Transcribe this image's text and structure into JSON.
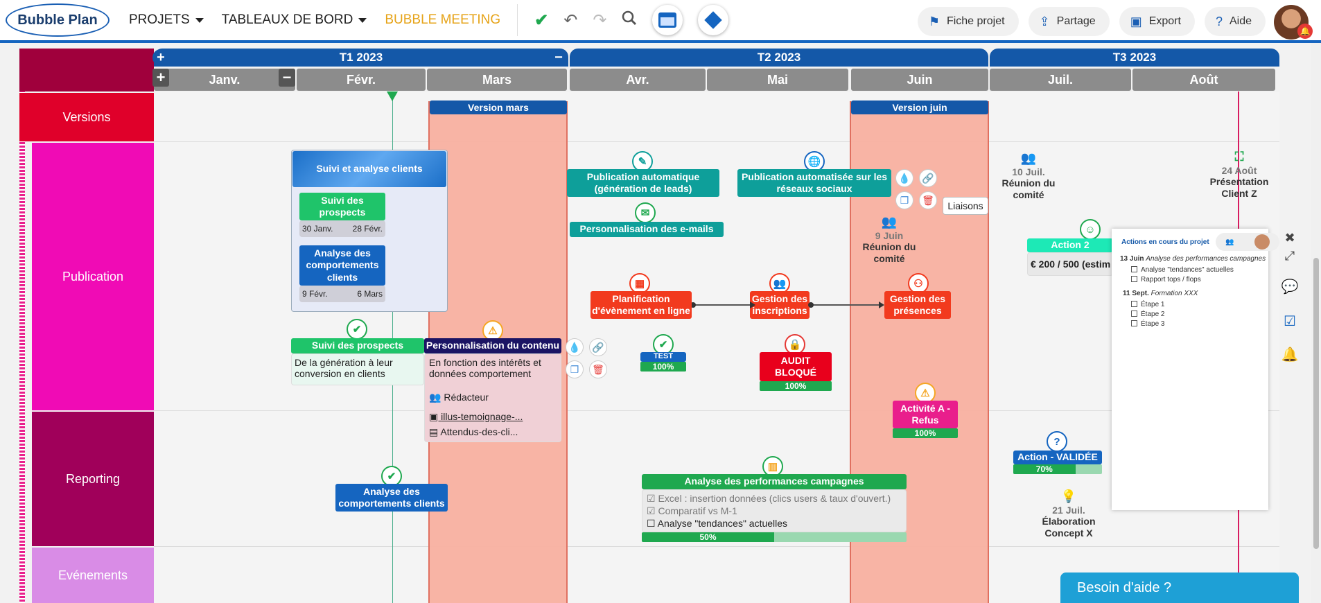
{
  "topbar": {
    "logo_text": "Bubble Plan",
    "nav": [
      {
        "label": "PROJETS"
      },
      {
        "label": "TABLEAUX DE BORD"
      },
      {
        "label": "BUBBLE MEETING"
      }
    ],
    "right_buttons": [
      {
        "label": "Fiche projet",
        "icon": "flag-icon"
      },
      {
        "label": "Partage",
        "icon": "share-icon"
      },
      {
        "label": "Export",
        "icon": "image-icon"
      },
      {
        "label": "Aide",
        "icon": "help-icon"
      }
    ]
  },
  "timeline": {
    "quarters": [
      "T1 2023",
      "T2 2023",
      "T3 2023"
    ],
    "months": [
      "Janv.",
      "Févr.",
      "Mars",
      "Avr.",
      "Mai",
      "Juin",
      "Juil.",
      "Août"
    ],
    "versions": [
      "Version mars",
      "Version juin"
    ]
  },
  "rows": [
    "Versions",
    "Publication",
    "Reporting",
    "Evénements"
  ],
  "tasks": {
    "suivi_analyse_title": "Suivi et analyse clients",
    "suivi_prospects_sub": "Suivi des prospects",
    "suivi_prospects_start": "30 Janv.",
    "suivi_prospects_end": "28 Févr.",
    "analyse_comp_sub": "Analyse des comportements clients",
    "analyse_comp_start": "9 Févr.",
    "analyse_comp_end": "6 Mars",
    "suivi_prospects_title": "Suivi des prospects",
    "suivi_prospects_desc": "De la génération à leur conversion en clients",
    "perso_title": "Personnalisation du contenu",
    "perso_desc": "En fonction des intérêts et données comportement",
    "perso_role": "Rédacteur",
    "perso_file1": "illus-temoignage-...",
    "perso_file2": "Attendus-des-cli...",
    "pub_auto_leads": "Publication automatique (génération de leads)",
    "perso_emails": "Personnalisation des e-mails",
    "pub_auto_social": "Publication automatisée sur les réseaux sociaux",
    "tooltip_liaisons": "Liaisons",
    "planif": "Planification d'évènement en ligne",
    "gestion_inscr": "Gestion des inscriptions",
    "gestion_pres": "Gestion des présences",
    "test_label": "TEST",
    "test_progress": "100%",
    "audit_label": "AUDIT BLOQUÉ",
    "audit_progress": "100%",
    "activite_label": "Activité A - Refus",
    "activite_progress": "100%",
    "analyse_comp2": "Analyse des comportements clients",
    "analyse_perf_title": "Analyse des performances campagnes",
    "analyse_perf_items": [
      "Excel : insertion données (clics users & taux d'ouvert.)",
      "Comparatif vs M-1",
      "Analyse \"tendances\" actuelles"
    ],
    "analyse_perf_progress": "50%",
    "action_validee": "Action - VALIDÉE",
    "action_validee_progress": "70%",
    "action2_label": "Action 2",
    "action2_budget": "€ 200 / 500 (estim"
  },
  "milestones": {
    "m1_date": "10 Juil.",
    "m1_label": "Réunion du comité",
    "m2_date": "9 Juin",
    "m2_label": "Réunion du comité",
    "m3_date": "24 Août",
    "m3_label": "Présentation Client Z",
    "m4_date": "21 Juil.",
    "m4_label": "Élaboration Concept X"
  },
  "action_panel": {
    "title": "Actions en cours du projet",
    "g1_date": "13 Juin",
    "g1_title": "Analyse des performances campagnes",
    "g1_items": [
      "Analyse \"tendances\" actuelles",
      "Rapport tops / flops"
    ],
    "g2_date": "11 Sept.",
    "g2_title": "Formation XXX",
    "g2_items": [
      "Étape 1",
      "Étape 2",
      "Étape 3"
    ]
  },
  "help_label": "Besoin d'aide ?",
  "colors": {
    "brand": "#1565c0",
    "teal": "#0e9f9a",
    "red": "#f23a1e",
    "green": "#1fc46a",
    "magenta": "#e91e8c"
  }
}
